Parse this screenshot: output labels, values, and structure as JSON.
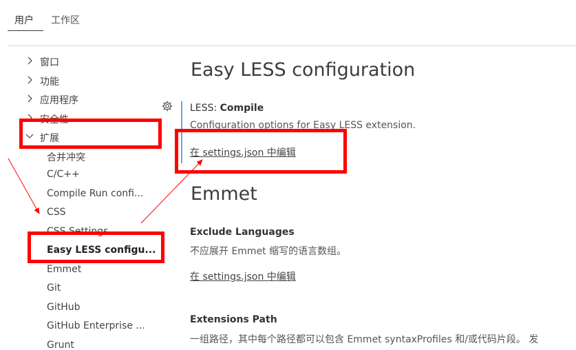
{
  "tabs": [
    {
      "label": "用户"
    },
    {
      "label": "工作区"
    }
  ],
  "tree": {
    "top_items": [
      "窗口",
      "功能",
      "应用程序",
      "安全性"
    ],
    "extensions_label": "扩展",
    "extensions_children": [
      "合并冲突",
      "C/C++",
      "Compile Run confi...",
      "CSS",
      "CSS Settings",
      "Easy LESS configu...",
      "Emmet",
      "Git",
      "GitHub",
      "GitHub Enterprise ...",
      "Grunt"
    ]
  },
  "main": {
    "easy_less": {
      "heading": "Easy LESS configuration",
      "setting_category": "LESS: ",
      "setting_name": "Compile",
      "description": "Configuration options for Easy LESS extension.",
      "edit_link": "在 settings.json 中编辑"
    },
    "emmet": {
      "heading": "Emmet",
      "exclude": {
        "title": "Exclude Languages",
        "description": "不应展开 Emmet 缩写的语言数组。",
        "edit_link": "在 settings.json 中编辑"
      },
      "extensions_path": {
        "title": "Extensions Path",
        "description": "一组路径，其中每个路径都可以包含 Emmet syntaxProfiles 和/或代码片段。 发"
      }
    }
  },
  "annotation_color": "#ff0000",
  "accent_bar_color": "#6aa8d8",
  "icons": [
    "chevron-right-icon",
    "chevron-down-icon",
    "gear-icon"
  ]
}
